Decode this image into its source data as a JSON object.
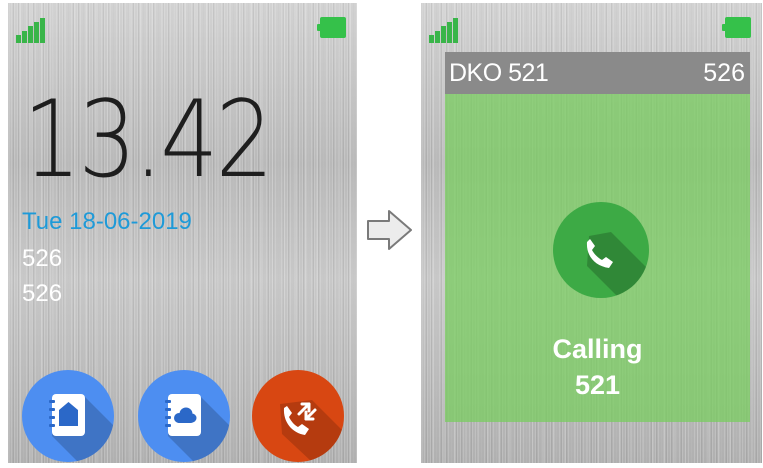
{
  "idle_screen": {
    "status": {
      "signal_icon": "signal-icon",
      "battery_icon": "battery-icon"
    },
    "time": "13.42",
    "date": "Tue 18-06-2019",
    "line1": "526",
    "line2": "526",
    "apps": [
      {
        "icon": "home-contacts-icon",
        "color": "#4d8ef1"
      },
      {
        "icon": "cloud-contacts-icon",
        "color": "#4d8ef1"
      },
      {
        "icon": "call-log-icon",
        "color": "#d84712"
      }
    ],
    "colors": {
      "date": "#1e9ad8",
      "signal": "#39b549",
      "battery": "#35c14a"
    }
  },
  "transition_icon": "right-arrow-icon",
  "calling_screen": {
    "header_left": "DKO 521",
    "header_right": "526",
    "status": "Calling",
    "number": "521",
    "call_icon": "phone-icon",
    "colors": {
      "panel": "#7fcd62",
      "call_button": "#3daa45",
      "header": "#8a8a8a"
    }
  }
}
